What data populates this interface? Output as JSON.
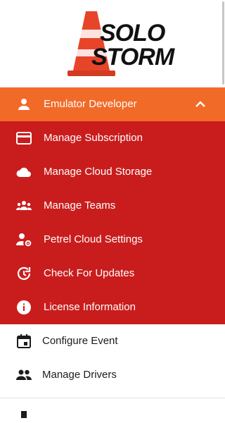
{
  "logo": {
    "line1": "SOLO",
    "line2": "STORM",
    "colors": {
      "cone": "#e8442a",
      "cone_stripe": "#ffffff"
    }
  },
  "account": {
    "label": "Emulator Developer",
    "icon": "person-icon",
    "expand_icon": "chevron-up-icon",
    "color": "#f26a28"
  },
  "submenu": {
    "color": "#c91d1d",
    "items": [
      {
        "label": "Manage Subscription",
        "icon": "credit-card-icon"
      },
      {
        "label": "Manage Cloud Storage",
        "icon": "cloud-icon"
      },
      {
        "label": "Manage Teams",
        "icon": "group-icon"
      },
      {
        "label": "Petrel Cloud Settings",
        "icon": "person-gear-icon"
      },
      {
        "label": "Check For Updates",
        "icon": "update-icon"
      },
      {
        "label": "License Information",
        "icon": "info-icon"
      }
    ]
  },
  "main_menu": {
    "items": [
      {
        "label": "Configure Event",
        "icon": "calendar-icon"
      },
      {
        "label": "Manage Drivers",
        "icon": "people-icon"
      }
    ]
  }
}
